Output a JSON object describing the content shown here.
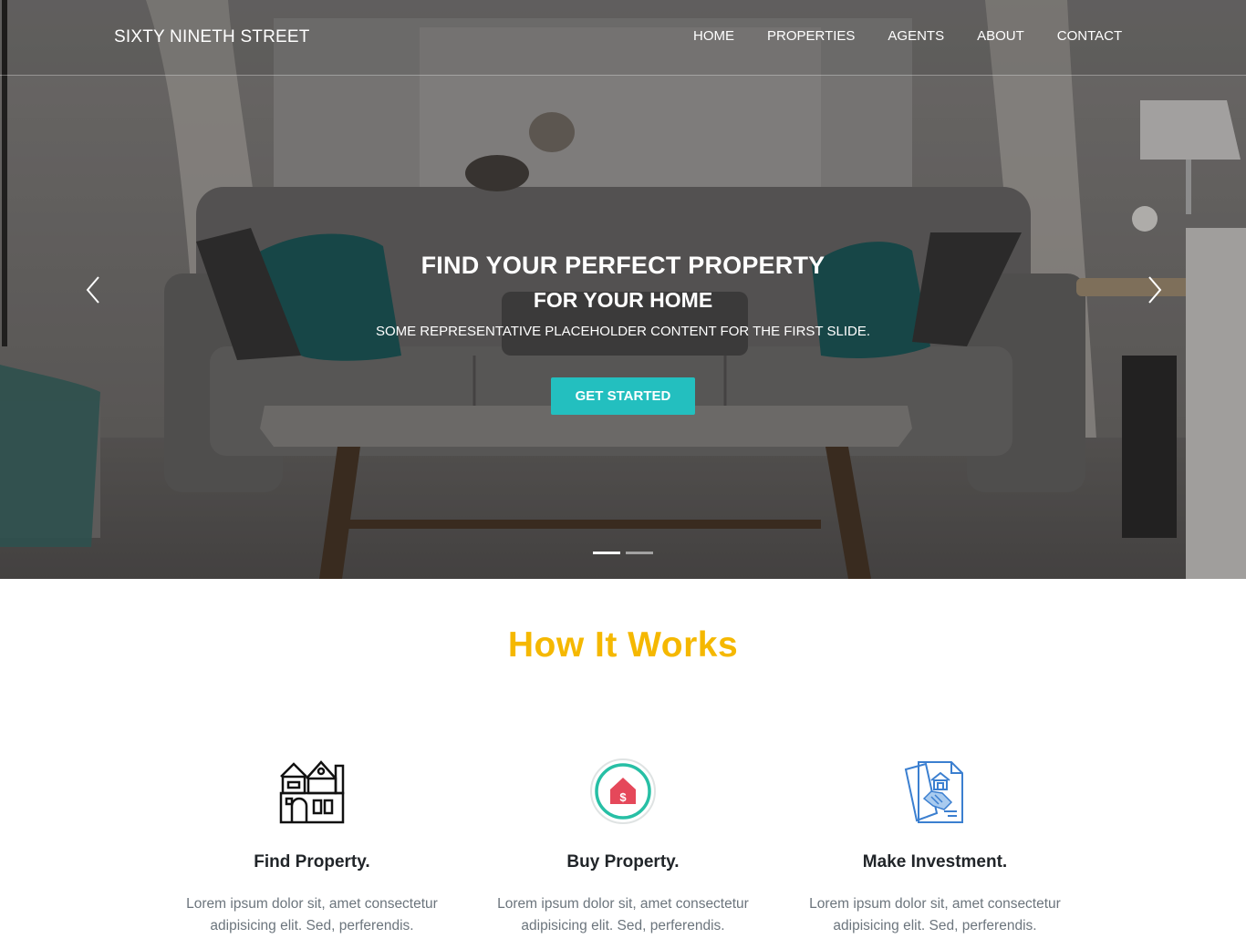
{
  "nav": {
    "brand": "SIXTY NINETH STREET",
    "links": [
      "HOME",
      "PROPERTIES",
      "AGENTS",
      "ABOUT",
      "CONTACT"
    ]
  },
  "hero": {
    "title": "FIND YOUR PERFECT PROPERTY",
    "subtitle": "FOR YOUR HOME",
    "text": "SOME REPRESENTATIVE PLACEHOLDER CONTENT FOR THE FIRST SLIDE.",
    "cta_label": "GET STARTED",
    "slide_count": 2,
    "active_slide": 1,
    "accent_color": "#23bfbf"
  },
  "how_it_works": {
    "title": "How It Works",
    "title_color": "#f5b800",
    "features": [
      {
        "icon": "house-outline-icon",
        "title": "Find Property.",
        "text_line1": "Lorem ipsum dolor sit, amet consectetur",
        "text_line2": "adipisicing elit. Sed, perferendis."
      },
      {
        "icon": "house-dollar-badge-icon",
        "title": "Buy Property.",
        "text_line1": "Lorem ipsum dolor sit, amet consectetur",
        "text_line2": "adipisicing elit. Sed, perferendis."
      },
      {
        "icon": "handshake-contract-icon",
        "title": "Make Investment.",
        "text_line1": "Lorem ipsum dolor sit, amet consectetur",
        "text_line2": "adipisicing elit. Sed, perferendis."
      }
    ]
  }
}
